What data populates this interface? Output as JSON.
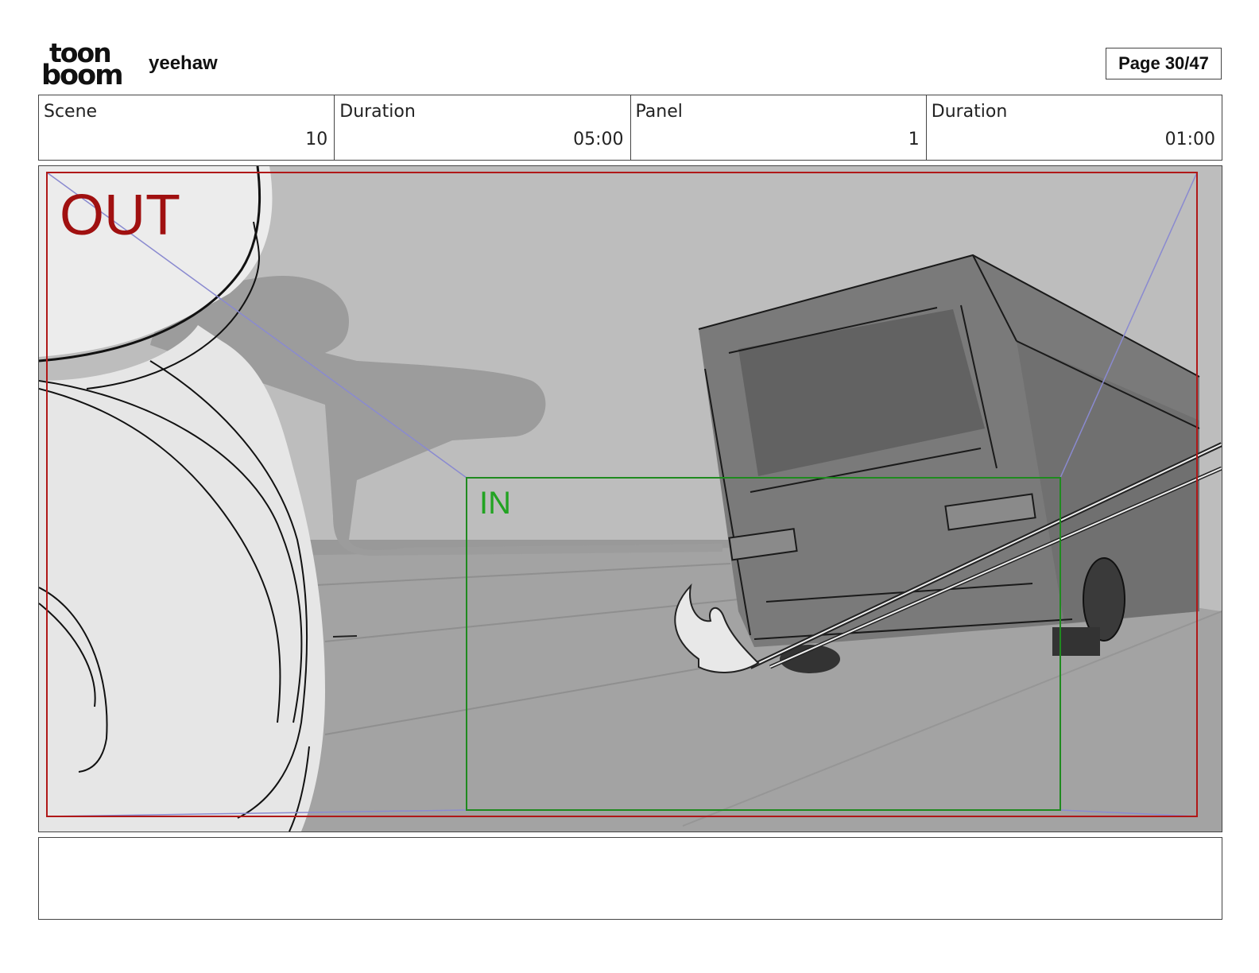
{
  "header": {
    "logo_line1": "toon",
    "logo_line2": "boom",
    "project_title": "yeehaw",
    "page_indicator": "Page 30/47"
  },
  "info": {
    "scene_label": "Scene",
    "scene_value": "10",
    "scene_duration_label": "Duration",
    "scene_duration_value": "05:00",
    "panel_label": "Panel",
    "panel_value": "1",
    "panel_duration_label": "Duration",
    "panel_duration_value": "01:00"
  },
  "panel": {
    "out_label": "OUT",
    "in_label": "IN",
    "colors": {
      "out_frame": "#b01818",
      "in_frame": "#1f8a1f",
      "guide_lines": "#8a8ad0"
    }
  },
  "notes": {
    "text": ""
  }
}
